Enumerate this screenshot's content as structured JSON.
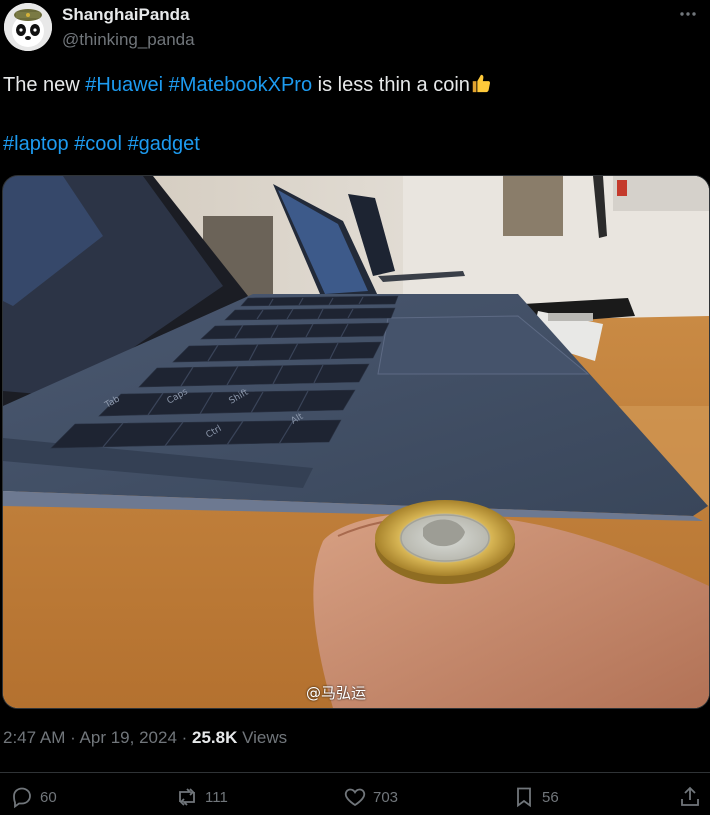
{
  "author": {
    "name": "ShanghaiPanda",
    "handle": "@thinking_panda"
  },
  "tweet": {
    "text_before": "The new ",
    "hashtag_1": "#Huawei",
    "space_1": " ",
    "hashtag_2": "#MatebookXPro",
    "text_after": " is less thin a coin",
    "emoji": "thumbs-up-emoji",
    "tags": [
      "#laptop",
      "#cool",
      "#gadget"
    ]
  },
  "photo": {
    "watermark": "@马弘运",
    "keyboard_keys": [
      "Ctrl",
      "Shift",
      "Caps",
      "Tab",
      "Alt"
    ]
  },
  "meta": {
    "time": "2:47 AM",
    "separator_1": " · ",
    "date": "Apr 19, 2024",
    "separator_2": " · ",
    "views_count": "25.8K",
    "views_label": " Views"
  },
  "actions": {
    "replies": "60",
    "retweets": "111",
    "likes": "703",
    "bookmarks": "56"
  },
  "colors": {
    "link": "#1d9bf0",
    "text": "#e7e9ea",
    "muted": "#71767b",
    "background": "#000000"
  }
}
